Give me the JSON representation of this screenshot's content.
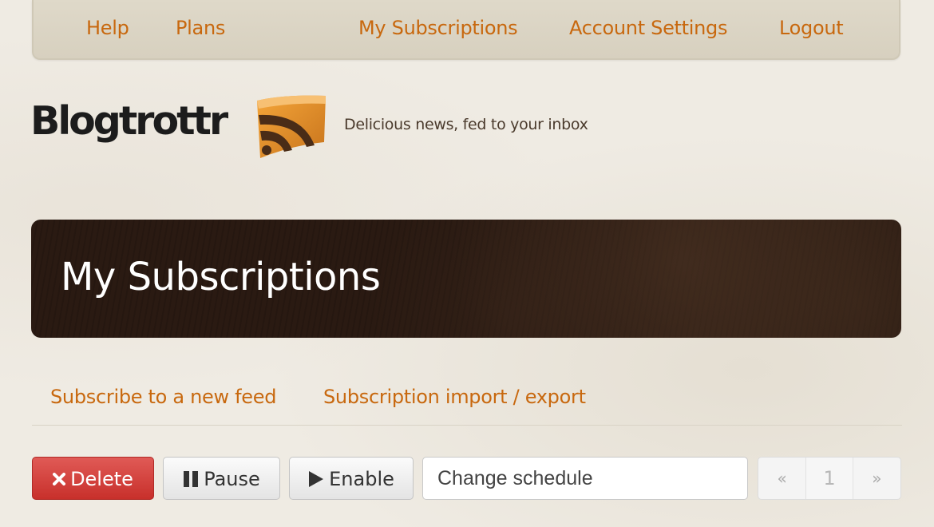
{
  "nav": {
    "help": "Help",
    "plans": "Plans",
    "my_subscriptions": "My Subscriptions",
    "account_settings": "Account Settings",
    "logout": "Logout"
  },
  "brand": {
    "logo_text": "Blogtrottr",
    "tagline": "Delicious news, fed to your inbox"
  },
  "page": {
    "title": "My Subscriptions"
  },
  "sublinks": {
    "subscribe_new": "Subscribe to a new feed",
    "import_export": "Subscription import / export"
  },
  "toolbar": {
    "delete_label": "Delete",
    "pause_label": "Pause",
    "enable_label": "Enable",
    "schedule_value": "Change schedule"
  },
  "pagination": {
    "prev": "«",
    "current": "1",
    "next": "»"
  },
  "colors": {
    "link": "#c8680e",
    "danger": "#d9433f",
    "banner": "#2a1a12",
    "background": "#efebe3"
  },
  "icons": {
    "delete": "close-icon",
    "pause": "pause-icon",
    "enable": "play-icon",
    "logo": "rss-feed-icon"
  }
}
